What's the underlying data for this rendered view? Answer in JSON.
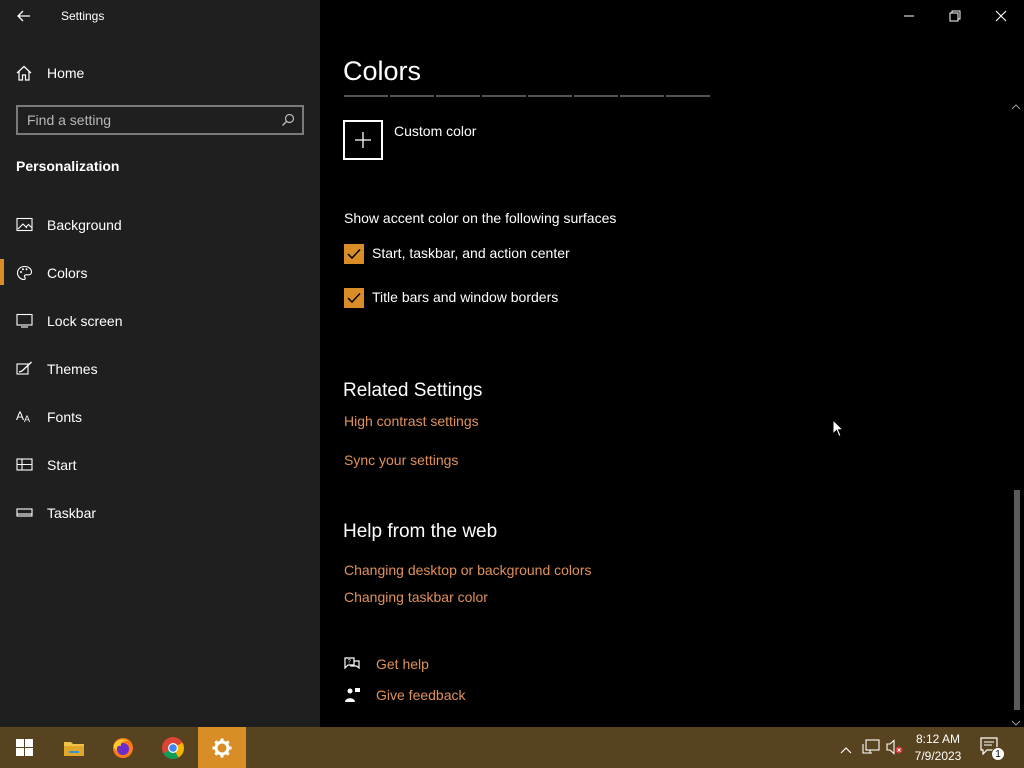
{
  "window": {
    "title": "Settings"
  },
  "sidebar": {
    "home_label": "Home",
    "search_placeholder": "Find a setting",
    "section_title": "Personalization",
    "items": [
      {
        "label": "Background",
        "icon": "picture-icon"
      },
      {
        "label": "Colors",
        "icon": "palette-icon",
        "selected": true
      },
      {
        "label": "Lock screen",
        "icon": "lock-screen-icon"
      },
      {
        "label": "Themes",
        "icon": "brush-icon"
      },
      {
        "label": "Fonts",
        "icon": "font-icon"
      },
      {
        "label": "Start",
        "icon": "start-layout-icon"
      },
      {
        "label": "Taskbar",
        "icon": "taskbar-icon"
      }
    ]
  },
  "main": {
    "title": "Colors",
    "custom_color_label": "Custom color",
    "surfaces_label": "Show accent color on the following surfaces",
    "checkboxes": [
      {
        "label": "Start, taskbar, and action center",
        "checked": true
      },
      {
        "label": "Title bars and window borders",
        "checked": true
      }
    ],
    "related_title": "Related Settings",
    "related_links": [
      "High contrast settings",
      "Sync your settings"
    ],
    "help_title": "Help from the web",
    "help_links": [
      "Changing desktop or background colors",
      "Changing taskbar color"
    ],
    "get_help": "Get help",
    "give_feedback": "Give feedback"
  },
  "taskbar": {
    "apps": [
      "start-icon",
      "file-explorer-icon",
      "firefox-icon",
      "chrome-icon",
      "settings-icon"
    ],
    "time": "8:12 AM",
    "date": "7/9/2023",
    "notification_count": "1"
  },
  "colors": {
    "accent": "#d98d27",
    "link": "#e0915a",
    "sidebar_bg": "#1f1f1f",
    "taskbar_bg": "#584320"
  }
}
